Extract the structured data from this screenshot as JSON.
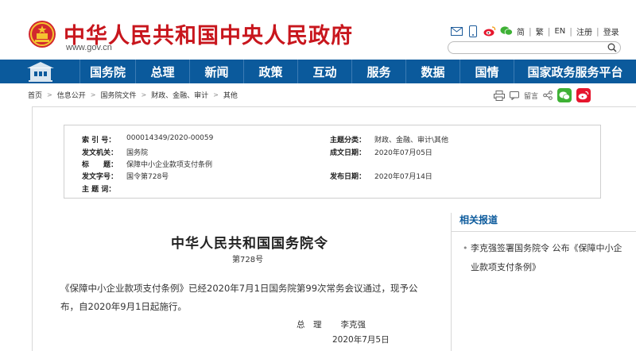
{
  "header": {
    "site_title": "中华人民共和国中央人民政府",
    "site_url": "www.gov.cn",
    "links": [
      "简",
      "繁",
      "EN",
      "注册",
      "登录"
    ],
    "search_placeholder": ""
  },
  "nav": {
    "items": [
      "国务院",
      "总理",
      "新闻",
      "政策",
      "互动",
      "服务",
      "数据",
      "国情",
      "国家政务服务平台"
    ]
  },
  "breadcrumb": [
    "首页",
    "信息公开",
    "国务院文件",
    "财政、金融、审计",
    "其他"
  ],
  "tools": {
    "print": "",
    "message": "留言"
  },
  "info": {
    "index_label": "索 引 号：",
    "index_value": "000014349/2020-00059",
    "category_label": "主题分类：",
    "category_value": "财政、金融、审计\\其他",
    "issuer_label": "发文机关：",
    "issuer_value": "国务院",
    "date_label": "成文日期：",
    "date_value": "2020年07月05日",
    "title_label": "标　　题：",
    "title_value": "保障中小企业款项支付条例",
    "docno_label": "发文字号：",
    "docno_value": "国令第728号",
    "pubdate_label": "发布日期：",
    "pubdate_value": "2020年07月14日",
    "keywords_label": "主 题 词："
  },
  "article": {
    "title": "中华人民共和国国务院令",
    "order_no": "第728号",
    "paragraph": "《保障中小企业款项支付条例》已经2020年7月1日国务院第99次常务会议通过，现予公布，自2020年9月1日起施行。",
    "sign_title": "总　理",
    "sign_name": "李克强",
    "sign_date": "2020年7月5日"
  },
  "related": {
    "title": "相关报道",
    "items": [
      "李克强签署国务院令 公布《保障中小企业款项支付条例》"
    ]
  },
  "colors": {
    "brand_red": "#c8161d",
    "nav_blue": "#0b5a9c"
  }
}
